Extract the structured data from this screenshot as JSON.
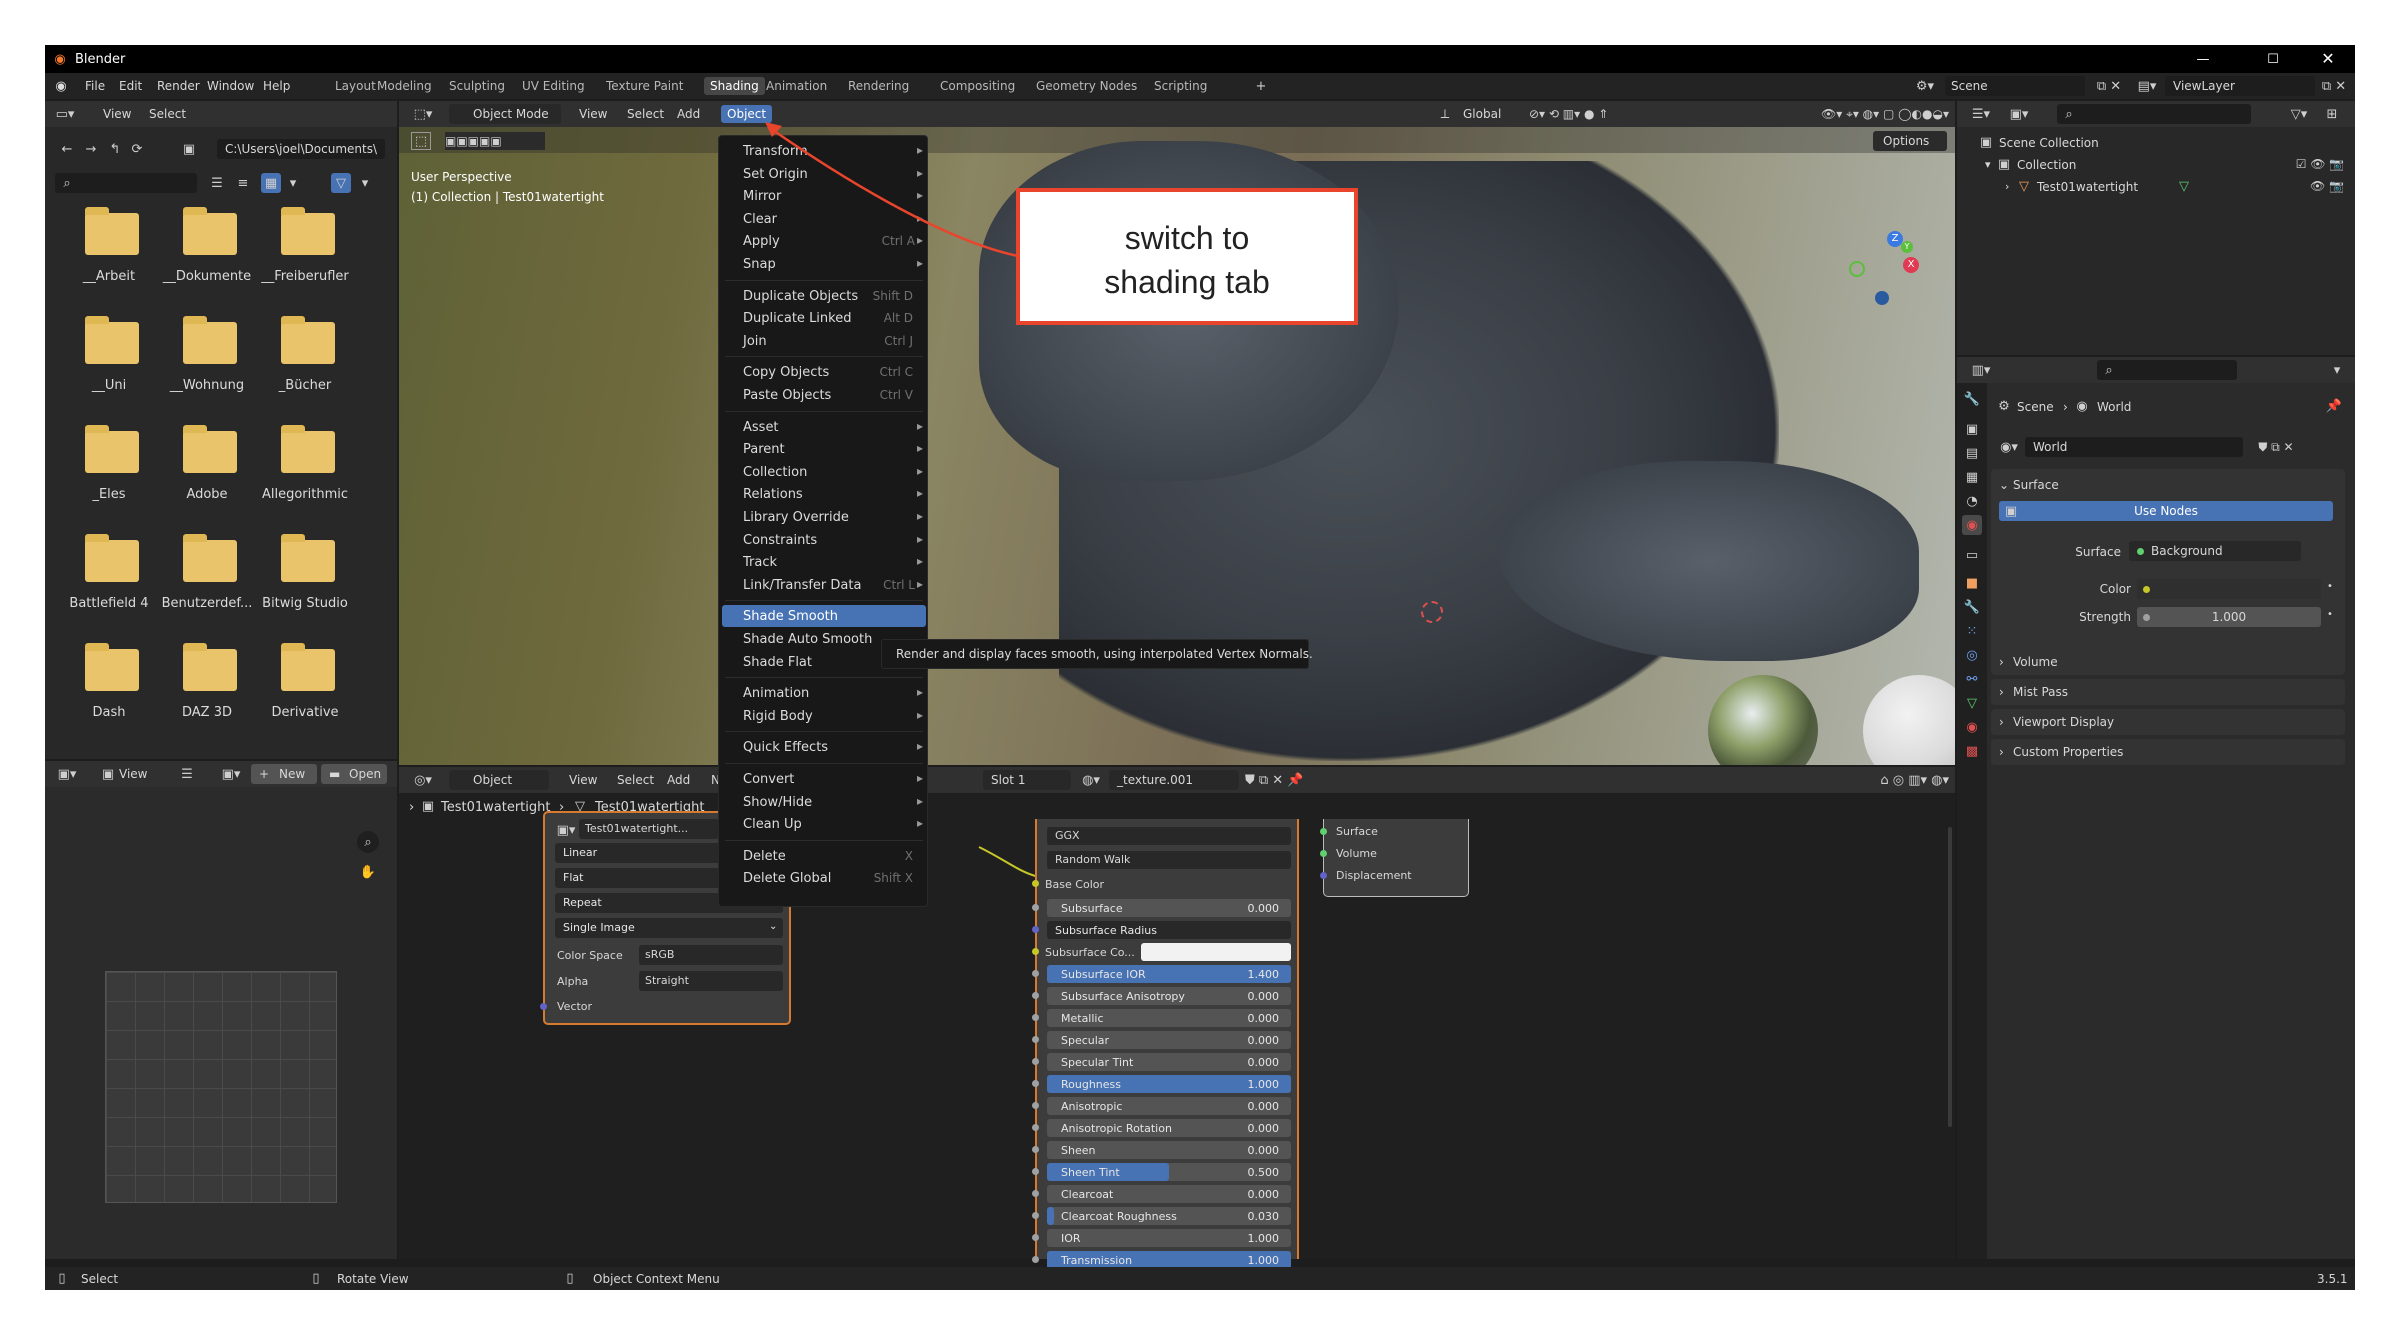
{
  "app": {
    "title": "Blender",
    "version": "3.5.1"
  },
  "menubar": {
    "items": [
      "File",
      "Edit",
      "Render",
      "Window",
      "Help"
    ]
  },
  "workspace_tabs": [
    "Layout",
    "Modeling",
    "Sculpting",
    "UV Editing",
    "Texture Paint",
    "Shading",
    "Animation",
    "Rendering",
    "Compositing",
    "Geometry Nodes",
    "Scripting"
  ],
  "active_workspace_tab": "Shading",
  "scene": {
    "name": "Scene",
    "view_layer": "ViewLayer"
  },
  "file_browser": {
    "menus": [
      "View",
      "Select"
    ],
    "path": "C:\\Users\\joel\\Documents\\",
    "folders": [
      "__Arbeit",
      "__Dokumente",
      "__Freiberufler",
      "__Uni",
      "__Wohnung",
      "_Bücher",
      "_Eles",
      "Adobe",
      "Allegorithmic",
      "Battlefield 4",
      "Benutzerdef...",
      "Bitwig Studio",
      "Dash",
      "DAZ 3D",
      "Derivative"
    ]
  },
  "viewport": {
    "mode": "Object Mode",
    "menus": [
      "View",
      "Select",
      "Add",
      "Object"
    ],
    "active_menu": "Object",
    "orientation": "Global",
    "options_label": "Options",
    "overlay_line1": "User Perspective",
    "overlay_line2": "(1) Collection | Test01watertight"
  },
  "object_menu": {
    "items": [
      {
        "label": "Transform",
        "shortcut": "",
        "arrow": true
      },
      {
        "label": "Set Origin",
        "shortcut": "",
        "arrow": true
      },
      {
        "label": "Mirror",
        "shortcut": "",
        "arrow": true
      },
      {
        "label": "Clear",
        "shortcut": "",
        "arrow": true
      },
      {
        "label": "Apply",
        "shortcut": "Ctrl A",
        "arrow": true
      },
      {
        "label": "Snap",
        "shortcut": "",
        "arrow": true
      },
      {
        "label": "Duplicate Objects",
        "shortcut": "Shift D",
        "arrow": false
      },
      {
        "label": "Duplicate Linked",
        "shortcut": "Alt D",
        "arrow": false
      },
      {
        "label": "Join",
        "shortcut": "Ctrl J",
        "arrow": false
      },
      {
        "label": "Copy Objects",
        "shortcut": "Ctrl C",
        "arrow": false
      },
      {
        "label": "Paste Objects",
        "shortcut": "Ctrl V",
        "arrow": false
      },
      {
        "label": "Asset",
        "shortcut": "",
        "arrow": true
      },
      {
        "label": "Parent",
        "shortcut": "",
        "arrow": true
      },
      {
        "label": "Collection",
        "shortcut": "",
        "arrow": true
      },
      {
        "label": "Relations",
        "shortcut": "",
        "arrow": true
      },
      {
        "label": "Library Override",
        "shortcut": "",
        "arrow": true
      },
      {
        "label": "Constraints",
        "shortcut": "",
        "arrow": true
      },
      {
        "label": "Track",
        "shortcut": "",
        "arrow": true
      },
      {
        "label": "Link/Transfer Data",
        "shortcut": "Ctrl L",
        "arrow": true
      },
      {
        "label": "Shade Smooth",
        "shortcut": "",
        "arrow": false
      },
      {
        "label": "Shade Auto Smooth",
        "shortcut": "",
        "arrow": false
      },
      {
        "label": "Shade Flat",
        "shortcut": "",
        "arrow": false
      },
      {
        "label": "Animation",
        "shortcut": "",
        "arrow": true
      },
      {
        "label": "Rigid Body",
        "shortcut": "",
        "arrow": true
      },
      {
        "label": "Quick Effects",
        "shortcut": "",
        "arrow": true
      },
      {
        "label": "Convert",
        "shortcut": "",
        "arrow": true
      },
      {
        "label": "Show/Hide",
        "shortcut": "",
        "arrow": true
      },
      {
        "label": "Clean Up",
        "shortcut": "",
        "arrow": true
      },
      {
        "label": "Delete",
        "shortcut": "X",
        "arrow": false
      },
      {
        "label": "Delete Global",
        "shortcut": "Shift X",
        "arrow": false
      }
    ],
    "highlighted": "Shade Smooth",
    "tooltip": "Render and display faces smooth, using interpolated Vertex Normals."
  },
  "callout": {
    "text_line1": "switch to",
    "text_line2": "shading tab"
  },
  "outliner": {
    "root": "Scene Collection",
    "collection": "Collection",
    "object": "Test01watertight"
  },
  "properties": {
    "breadcrumb_scene": "Scene",
    "breadcrumb_world": "World",
    "world_name": "World",
    "surface_panel": "Surface",
    "use_nodes": "Use Nodes",
    "surface_label": "Surface",
    "surface_value": "Background",
    "color_label": "Color",
    "strength_label": "Strength",
    "strength_value": "1.000",
    "panels": [
      "Volume",
      "Mist Pass",
      "Viewport Display",
      "Custom Properties"
    ]
  },
  "uv_editor": {
    "view": "View",
    "new": "New",
    "open": "Open"
  },
  "node_editor": {
    "object_label": "Object",
    "menus": [
      "View",
      "Select",
      "Add",
      "No"
    ],
    "slot": "Slot 1",
    "material": "_texture.001",
    "breadcrumb_obj": "Test01watertight",
    "breadcrumb_mesh": "Test01watertight",
    "image_name": "Test01watertight...",
    "image_node_rows": [
      "Linear",
      "Flat",
      "Repeat",
      "Single Image"
    ],
    "color_space_label": "Color Space",
    "color_space": "sRGB",
    "alpha_label": "Alpha",
    "alpha": "Straight",
    "vector_label": "Vector",
    "bsdf_dropdowns": [
      "GGX",
      "Random Walk"
    ],
    "base_color": "Base Color",
    "bsdf_rows": [
      {
        "label": "Subsurface",
        "value": "0.000",
        "fill": 0
      },
      {
        "label": "Subsurface Radius",
        "value": "",
        "fill": 0
      },
      {
        "label": "Subsurface Co...",
        "value": "",
        "fill": 0
      },
      {
        "label": "Subsurface IOR",
        "value": "1.400",
        "fill": 1
      },
      {
        "label": "Subsurface Anisotropy",
        "value": "0.000",
        "fill": 0
      },
      {
        "label": "Metallic",
        "value": "0.000",
        "fill": 0
      },
      {
        "label": "Specular",
        "value": "0.000",
        "fill": 0
      },
      {
        "label": "Specular Tint",
        "value": "0.000",
        "fill": 0
      },
      {
        "label": "Roughness",
        "value": "1.000",
        "fill": 1
      },
      {
        "label": "Anisotropic",
        "value": "0.000",
        "fill": 0
      },
      {
        "label": "Anisotropic Rotation",
        "value": "0.000",
        "fill": 0
      },
      {
        "label": "Sheen",
        "value": "0.000",
        "fill": 0
      },
      {
        "label": "Sheen Tint",
        "value": "0.500",
        "fill": 0.5
      },
      {
        "label": "Clearcoat",
        "value": "0.000",
        "fill": 0
      },
      {
        "label": "Clearcoat Roughness",
        "value": "0.030",
        "fill": 0.03
      },
      {
        "label": "IOR",
        "value": "1.000",
        "fill": 0
      },
      {
        "label": "Transmission",
        "value": "1.000",
        "fill": 1
      }
    ],
    "output_sockets": [
      "Surface",
      "Volume",
      "Displacement"
    ]
  },
  "statusbar": {
    "select": "Select",
    "rotate": "Rotate View",
    "context": "Object Context Menu"
  },
  "colors": {
    "accent": "#4772b3",
    "callout_border": "#e8452c",
    "folder": "#e9c46a"
  }
}
